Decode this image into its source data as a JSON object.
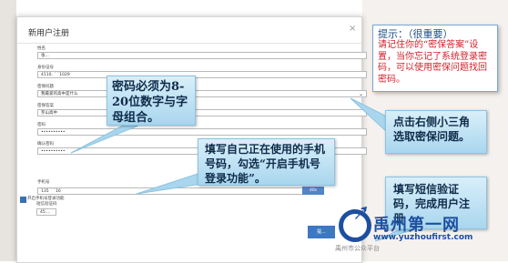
{
  "modal": {
    "title": "新用户注册",
    "close_icon": "×",
    "fields": [
      {
        "label": "姓名",
        "value": "张..."
      },
      {
        "label": "身份证号",
        "value": "4110.        `  `1029"
      },
      {
        "label": "密保问题",
        "value": "我最爱的高中是什么"
      },
      {
        "label": "密保答案",
        "value": "罗山高中"
      },
      {
        "label": "密码",
        "value": "••••••••••"
      },
      {
        "label": "确认密码",
        "value": "••••••••••"
      },
      {
        "label": "手机号",
        "value": "135   `   `16"
      },
      {
        "label": "短信验证码",
        "value": "45...."
      }
    ],
    "select_arrow": "⌄",
    "code_button": "40s",
    "checkbox_label": "开启手机号登录功能",
    "submit_label": "提..."
  },
  "tip": {
    "title": "提示：（很重要）",
    "body": "请记住你的“密保答案”设置，当你忘记了系统登录密码，可以使用密保问题找回密码。"
  },
  "callouts": {
    "password": "密码必须为8-20位数字与字母组合。",
    "phone": "填写自己正在使用的手机号码，勾选“开启手机号登录功能”。",
    "question": "点击右侧小三角选取密保问题。",
    "sms": "填写短信验证码，完成用户注册"
  },
  "logo": {
    "name": "禹州第一网",
    "url": "www.yuzhoufirst.com",
    "watermark": "禹州市公众平台"
  },
  "colors": {
    "callout_bg": "#a9d6ee",
    "tip_title": "#1e4f8a",
    "tip_body": "#d2222a",
    "logo_blue": "#1d4fa0",
    "button_blue": "#3c78c3"
  }
}
